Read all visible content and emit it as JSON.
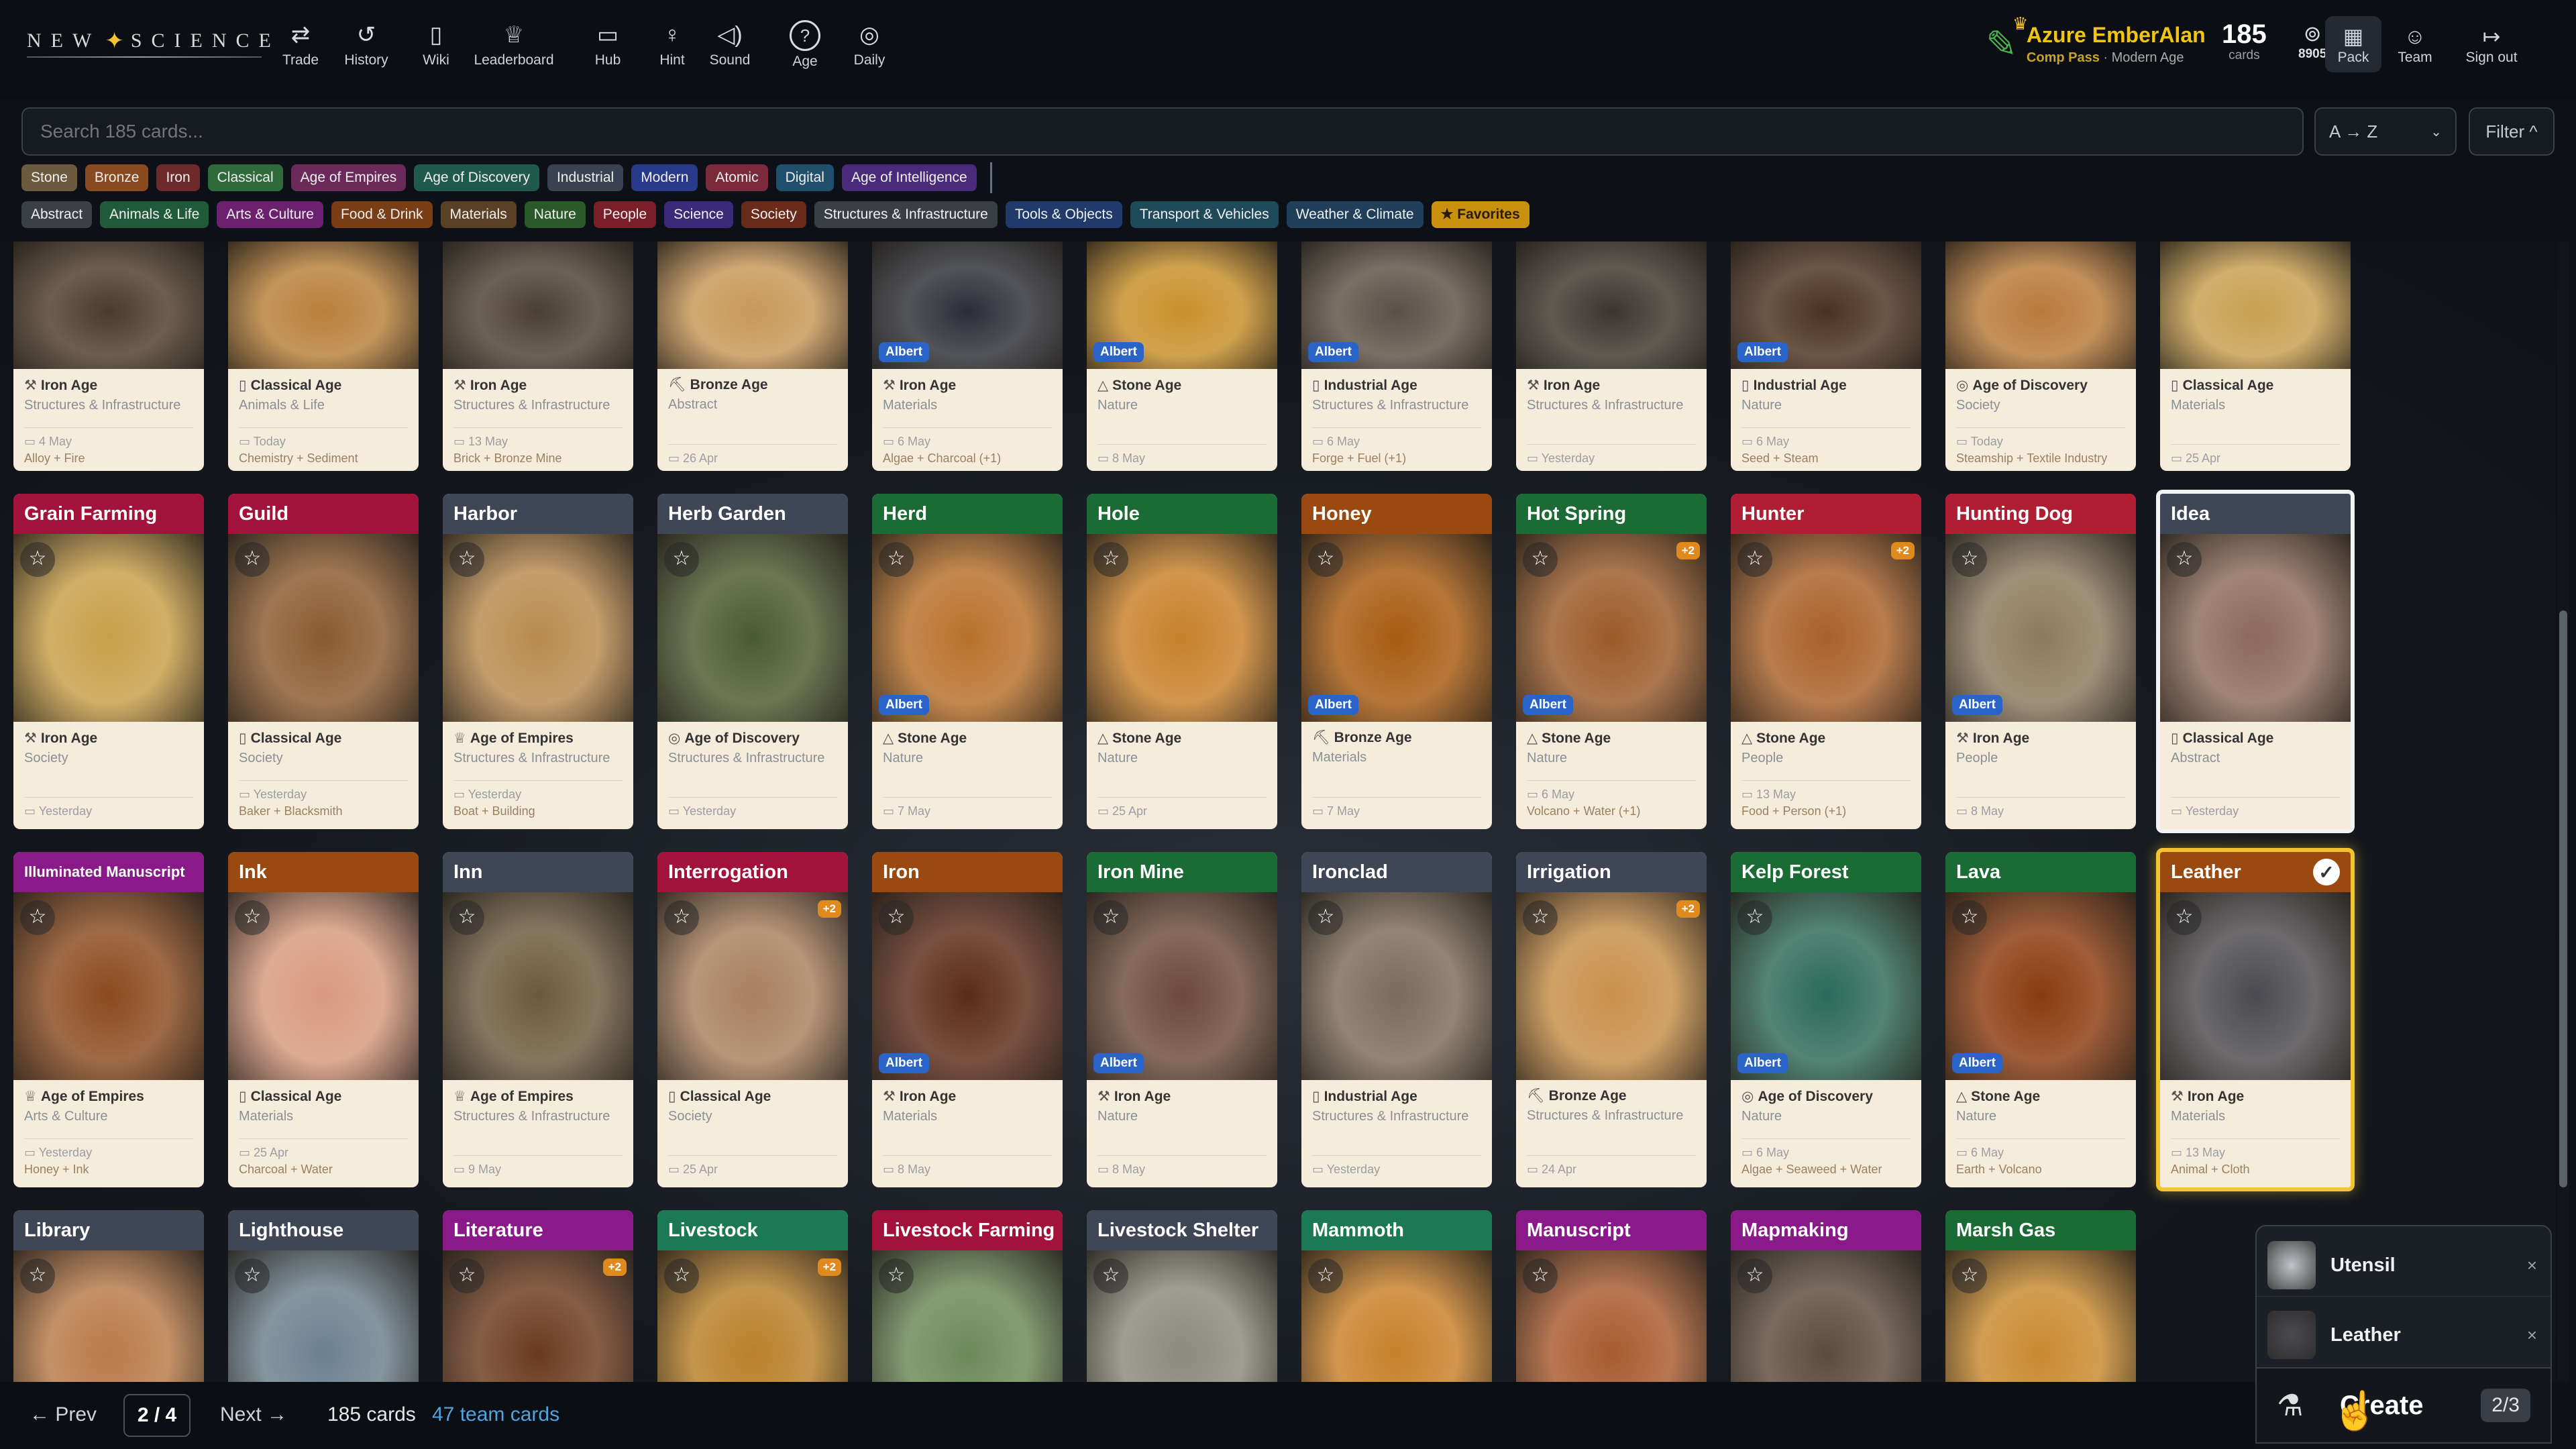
{
  "app": {
    "logo": "NEW SCIENCE"
  },
  "nav": [
    {
      "label": "Trade",
      "icon": "trade-icon",
      "glyph": "⇄"
    },
    {
      "label": "History",
      "icon": "history-icon",
      "glyph": "↺"
    },
    {
      "label": "Wiki",
      "icon": "book-icon",
      "glyph": "▯"
    },
    {
      "label": "Leaderboard",
      "icon": "trophy-icon",
      "glyph": "♕"
    },
    {
      "label": "Hub",
      "icon": "chat-icon",
      "glyph": "▭"
    },
    {
      "label": "Hint",
      "icon": "lightbulb-icon",
      "glyph": "♀"
    },
    {
      "label": "Sound",
      "icon": "speaker-icon",
      "glyph": "◁)"
    },
    {
      "label": "Age",
      "icon": "age-icon",
      "glyph": "?"
    },
    {
      "label": "Daily",
      "icon": "target-icon",
      "glyph": "◎"
    }
  ],
  "user": {
    "name": "Azure EmberAlan",
    "pass": "Comp Pass",
    "age": "Modern Age"
  },
  "stats": {
    "cards_count": "185",
    "cards_label": "cards",
    "coins": "8905"
  },
  "right_nav": [
    {
      "label": "Pack",
      "icon": "pack-icon",
      "glyph": "▦"
    },
    {
      "label": "Team",
      "icon": "team-icon",
      "glyph": "☺"
    },
    {
      "label": "Sign out",
      "icon": "signout-icon",
      "glyph": "↦"
    }
  ],
  "search": {
    "placeholder": "Search 185 cards..."
  },
  "sort": {
    "value": "A → Z"
  },
  "filter": {
    "label": "Filter ^"
  },
  "age_chips": [
    {
      "label": "Stone",
      "color": "#6b5a3e"
    },
    {
      "label": "Bronze",
      "color": "#8a4a1f"
    },
    {
      "label": "Iron",
      "color": "#6e2a2a"
    },
    {
      "label": "Classical",
      "color": "#2f6b3a"
    },
    {
      "label": "Age of Empires",
      "color": "#6b2a5a"
    },
    {
      "label": "Age of Discovery",
      "color": "#1f5a4a"
    },
    {
      "label": "Industrial",
      "color": "#3a4150"
    },
    {
      "label": "Modern",
      "color": "#2a3a8a"
    },
    {
      "label": "Atomic",
      "color": "#7a2a3a"
    },
    {
      "label": "Digital",
      "color": "#1f4f6b"
    },
    {
      "label": "Age of Intelligence",
      "color": "#4a2a7a"
    }
  ],
  "category_chips": [
    {
      "label": "Abstract",
      "color": "#3b3f46"
    },
    {
      "label": "Animals & Life",
      "color": "#1f5a3a"
    },
    {
      "label": "Arts & Culture",
      "color": "#6b2070"
    },
    {
      "label": "Food & Drink",
      "color": "#7a3e16"
    },
    {
      "label": "Materials",
      "color": "#5a4024"
    },
    {
      "label": "Nature",
      "color": "#2a5a2a"
    },
    {
      "label": "People",
      "color": "#7a1f2a"
    },
    {
      "label": "Science",
      "color": "#3a2a7a"
    },
    {
      "label": "Society",
      "color": "#6a2a1a"
    },
    {
      "label": "Structures & Infrastructure",
      "color": "#3a3f46"
    },
    {
      "label": "Tools & Objects",
      "color": "#1f3a6b"
    },
    {
      "label": "Transport & Vehicles",
      "color": "#1f4a5a"
    },
    {
      "label": "Weather & Climate",
      "color": "#1f3f5a"
    },
    {
      "label": "★ Favorites",
      "color": "#c9920e"
    }
  ],
  "cards_top_partial": [
    {
      "age": "Iron Age",
      "age_icon": "⚒",
      "category": "Structures & Infrastructure",
      "date": "4 May",
      "recipe": "Alloy + Fire",
      "albert": false,
      "tone": "#4a3a2a"
    },
    {
      "age": "Classical Age",
      "age_icon": "▯",
      "category": "Animals & Life",
      "date": "Today",
      "recipe": "Chemistry + Sediment",
      "albert": false,
      "tone": "#b8803a"
    },
    {
      "age": "Iron Age",
      "age_icon": "⚒",
      "category": "Structures & Infrastructure",
      "date": "13 May",
      "recipe": "Brick + Bronze Mine",
      "albert": false,
      "tone": "#4a3f35"
    },
    {
      "age": "Bronze Age",
      "age_icon": "⛏",
      "category": "Abstract",
      "date": "26 Apr",
      "recipe": "",
      "albert": false,
      "tone": "#c8985a"
    },
    {
      "age": "Iron Age",
      "age_icon": "⚒",
      "category": "Materials",
      "date": "6 May",
      "recipe": "Algae + Charcoal (+1)",
      "albert": true,
      "tone": "#2a2e38"
    },
    {
      "age": "Stone Age",
      "age_icon": "△",
      "category": "Nature",
      "date": "8 May",
      "recipe": "",
      "albert": true,
      "tone": "#c8902a"
    },
    {
      "age": "Industrial Age",
      "age_icon": "▯",
      "category": "Structures & Infrastructure",
      "date": "6 May",
      "recipe": "Forge + Fuel (+1)",
      "albert": true,
      "tone": "#5a5048"
    },
    {
      "age": "Iron Age",
      "age_icon": "⚒",
      "category": "Structures & Infrastructure",
      "date": "Yesterday",
      "recipe": "",
      "albert": false,
      "tone": "#3a3530"
    },
    {
      "age": "Industrial Age",
      "age_icon": "▯",
      "category": "Nature",
      "date": "6 May",
      "recipe": "Seed + Steam",
      "albert": true,
      "tone": "#4a3020"
    },
    {
      "age": "Age of Discovery",
      "age_icon": "◎",
      "category": "Society",
      "date": "Today",
      "recipe": "Steamship + Textile Industry",
      "albert": false,
      "tone": "#b87a3a"
    },
    {
      "age": "Classical Age",
      "age_icon": "▯",
      "category": "Materials",
      "date": "25 Apr",
      "recipe": "",
      "albert": false,
      "tone": "#c8a050"
    }
  ],
  "cards_row2": [
    {
      "name": "Grain Farming",
      "head": "#a3123a",
      "age": "Iron Age",
      "age_icon": "⚒",
      "category": "Society",
      "date": "Yesterday",
      "recipe": "",
      "albert": false,
      "plus2": false,
      "tone": "#c8a04a"
    },
    {
      "name": "Guild",
      "head": "#a3123a",
      "age": "Classical Age",
      "age_icon": "▯",
      "category": "Society",
      "date": "Yesterday",
      "recipe": "Baker + Blacksmith",
      "albert": false,
      "plus2": false,
      "tone": "#8a5a30"
    },
    {
      "name": "Harbor",
      "head": "#3f4656",
      "age": "Age of Empires",
      "age_icon": "♕",
      "category": "Structures & Infrastructure",
      "date": "Yesterday",
      "recipe": "Boat + Building",
      "albert": false,
      "plus2": false,
      "tone": "#b88a50"
    },
    {
      "name": "Herb Garden",
      "head": "#3f4656",
      "age": "Age of Discovery",
      "age_icon": "◎",
      "category": "Structures & Infrastructure",
      "date": "Yesterday",
      "recipe": "",
      "albert": false,
      "plus2": false,
      "tone": "#4a5a30"
    },
    {
      "name": "Herd",
      "head": "#1b6b35",
      "age": "Stone Age",
      "age_icon": "△",
      "category": "Nature",
      "date": "7 May",
      "recipe": "",
      "albert": true,
      "plus2": false,
      "tone": "#b8702a"
    },
    {
      "name": "Hole",
      "head": "#1b6b35",
      "age": "Stone Age",
      "age_icon": "△",
      "category": "Nature",
      "date": "25 Apr",
      "recipe": "",
      "albert": false,
      "plus2": false,
      "tone": "#c8802a"
    },
    {
      "name": "Honey",
      "head": "#9a4a10",
      "age": "Bronze Age",
      "age_icon": "⛏",
      "category": "Materials",
      "date": "7 May",
      "recipe": "",
      "albert": true,
      "plus2": false,
      "tone": "#a85a10"
    },
    {
      "name": "Hot Spring",
      "head": "#1b6b35",
      "age": "Stone Age",
      "age_icon": "△",
      "category": "Nature",
      "date": "6 May",
      "recipe": "Volcano + Water (+1)",
      "albert": true,
      "plus2": true,
      "tone": "#9a5a2a"
    },
    {
      "name": "Hunter",
      "head": "#b01e34",
      "age": "Stone Age",
      "age_icon": "△",
      "category": "People",
      "date": "13 May",
      "recipe": "Food + Person (+1)",
      "albert": false,
      "plus2": true,
      "tone": "#a8602a"
    },
    {
      "name": "Hunting Dog",
      "head": "#b01e34",
      "age": "Iron Age",
      "age_icon": "⚒",
      "category": "People",
      "date": "8 May",
      "recipe": "",
      "albert": true,
      "plus2": false,
      "tone": "#8a7a60"
    },
    {
      "name": "Idea",
      "head": "#3f4656",
      "age": "Classical Age",
      "age_icon": "▯",
      "category": "Abstract",
      "date": "Yesterday",
      "recipe": "",
      "albert": false,
      "plus2": false,
      "tone": "#8a6a5a"
    }
  ],
  "cards_row3": [
    {
      "name": "Illuminated Manuscript",
      "head": "#8a1a8a",
      "age": "Age of Empires",
      "age_icon": "♕",
      "category": "Arts & Culture",
      "date": "Yesterday",
      "recipe": "Honey + Ink",
      "albert": false,
      "plus2": false,
      "tone": "#8a4a20"
    },
    {
      "name": "Ink",
      "head": "#9a4a10",
      "age": "Classical Age",
      "age_icon": "▯",
      "category": "Materials",
      "date": "25 Apr",
      "recipe": "Charcoal + Water",
      "albert": false,
      "plus2": false,
      "tone": "#d89a80"
    },
    {
      "name": "Inn",
      "head": "#3f4656",
      "age": "Age of Empires",
      "age_icon": "♕",
      "category": "Structures & Infrastructure",
      "date": "9 May",
      "recipe": "",
      "albert": false,
      "plus2": false,
      "tone": "#6a5a40"
    },
    {
      "name": "Interrogation",
      "head": "#a3123a",
      "age": "Classical Age",
      "age_icon": "▯",
      "category": "Society",
      "date": "25 Apr",
      "recipe": "",
      "albert": false,
      "plus2": true,
      "tone": "#a88060"
    },
    {
      "name": "Iron",
      "head": "#9a4a10",
      "age": "Iron Age",
      "age_icon": "⚒",
      "category": "Materials",
      "date": "8 May",
      "recipe": "",
      "albert": true,
      "plus2": false,
      "tone": "#5a2a1a"
    },
    {
      "name": "Iron Mine",
      "head": "#1b6b35",
      "age": "Iron Age",
      "age_icon": "⚒",
      "category": "Nature",
      "date": "8 May",
      "recipe": "",
      "albert": true,
      "plus2": false,
      "tone": "#6a4a3a"
    },
    {
      "name": "Ironclad",
      "head": "#3f4656",
      "age": "Industrial Age",
      "age_icon": "▯",
      "category": "Structures & Infrastructure",
      "date": "Yesterday",
      "recipe": "",
      "albert": false,
      "plus2": false,
      "tone": "#7a6a5a"
    },
    {
      "name": "Irrigation",
      "head": "#3f4656",
      "age": "Bronze Age",
      "age_icon": "⛏",
      "category": "Structures & Infrastructure",
      "date": "24 Apr",
      "recipe": "",
      "albert": false,
      "plus2": true,
      "tone": "#c8904a"
    },
    {
      "name": "Kelp Forest",
      "head": "#1b6b35",
      "age": "Age of Discovery",
      "age_icon": "◎",
      "category": "Nature",
      "date": "6 May",
      "recipe": "Algae + Seaweed + Water",
      "albert": true,
      "plus2": false,
      "tone": "#2a6a5a"
    },
    {
      "name": "Lava",
      "head": "#1b6b35",
      "age": "Stone Age",
      "age_icon": "△",
      "category": "Nature",
      "date": "6 May",
      "recipe": "Earth + Volcano",
      "albert": true,
      "plus2": false,
      "tone": "#8a3a10"
    },
    {
      "name": "Leather",
      "head": "#9a4a10",
      "age": "Iron Age",
      "age_icon": "⚒",
      "category": "Materials",
      "date": "13 May",
      "recipe": "Animal + Cloth",
      "albert": false,
      "plus2": false,
      "tone": "#4a4a50"
    }
  ],
  "cards_row4": [
    {
      "name": "Library",
      "head": "#3f4656",
      "plus2": false,
      "tone": "#b87a4a"
    },
    {
      "name": "Lighthouse",
      "head": "#3f4656",
      "plus2": false,
      "tone": "#6a8090"
    },
    {
      "name": "Literature",
      "head": "#8a1a8a",
      "plus2": true,
      "tone": "#6a3a20"
    },
    {
      "name": "Livestock",
      "head": "#1b7a55",
      "plus2": true,
      "tone": "#b8802a"
    },
    {
      "name": "Livestock Farming",
      "head": "#a3123a",
      "plus2": false,
      "tone": "#6a8a5a"
    },
    {
      "name": "Livestock Shelter",
      "head": "#3f4656",
      "plus2": false,
      "tone": "#8a8a80"
    },
    {
      "name": "Mammoth",
      "head": "#1b7a55",
      "plus2": false,
      "tone": "#c8802a"
    },
    {
      "name": "Manuscript",
      "head": "#8a1a8a",
      "plus2": false,
      "tone": "#a85a30"
    },
    {
      "name": "Mapmaking",
      "head": "#8a1a8a",
      "plus2": false,
      "tone": "#5a4a40"
    },
    {
      "name": "Marsh Gas",
      "head": "#1b6b35",
      "plus2": false,
      "tone": "#c88a30"
    }
  ],
  "labels": {
    "albert": "Albert",
    "plus2": "+2"
  },
  "create_panel": {
    "items": [
      {
        "name": "Utensil",
        "tone": "#c0c4c8"
      },
      {
        "name": "Leather",
        "tone": "#4a4a50"
      }
    ],
    "create_label": "Create",
    "count": "2/3"
  },
  "pagination": {
    "prev": "← Prev",
    "page": "2 / 4",
    "next": "Next →",
    "total": "185 cards",
    "team": "47 team cards"
  }
}
